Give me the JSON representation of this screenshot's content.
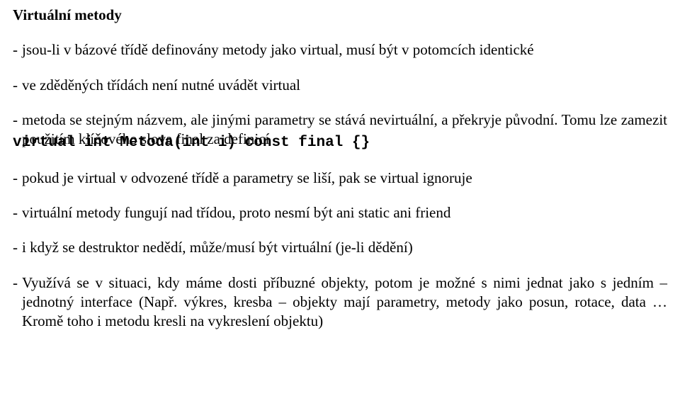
{
  "title": "Virtuální metody",
  "b1": "jsou-li v bázové třídě definovány metody jako virtual, musí být v potomcích identické",
  "b2": "ve zděděných třídách není nutné uvádět virtual",
  "b3": "metoda se stejným názvem, ale jinými parametry se stává nevirtuální, a překryje původní. Tomu lze zamezit použitím klíčového slova final za definicí",
  "code3": "virtual int Metoda(int i) const final {}",
  "b4": "pokud je virtual v odvozené třídě a parametry se liší, pak se virtual ignoruje",
  "b5": "virtuální metody fungují nad třídou, proto nesmí být ani static ani friend",
  "b6": "i když se destruktor nedědí, může/musí být virtuální (je-li dědění)",
  "b7": "Využívá se v situaci, kdy máme dosti příbuzné objekty, potom je možné s nimi jednat jako s jedním – jednotný interface (Např. výkres, kresba – objekty mají parametry, metody jako posun, rotace, data … Kromě toho i metodu kresli na vykreslení objektu)",
  "dash": "-"
}
